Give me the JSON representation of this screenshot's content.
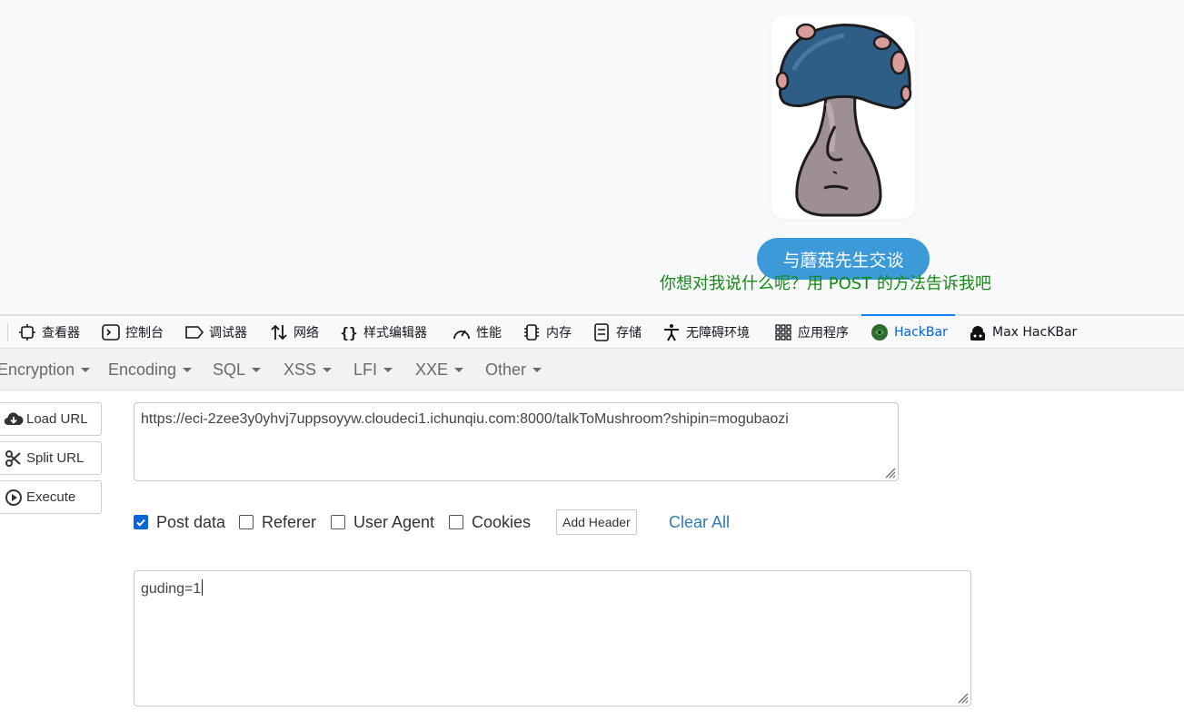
{
  "page": {
    "talk_button": "与蘑菇先生交谈",
    "hint": "你想对我说什么呢？用 POST 的方法告诉我吧"
  },
  "devtools": {
    "tabs": [
      {
        "label": "查看器",
        "icon": "inspector-icon"
      },
      {
        "label": "控制台",
        "icon": "console-icon"
      },
      {
        "label": "调试器",
        "icon": "debugger-icon"
      },
      {
        "label": "网络",
        "icon": "network-icon"
      },
      {
        "label": "样式编辑器",
        "icon": "style-editor-icon"
      },
      {
        "label": "性能",
        "icon": "performance-icon"
      },
      {
        "label": "内存",
        "icon": "memory-icon"
      },
      {
        "label": "存储",
        "icon": "storage-icon"
      },
      {
        "label": "无障碍环境",
        "icon": "accessibility-icon"
      },
      {
        "label": "应用程序",
        "icon": "application-icon"
      },
      {
        "label": "HackBar",
        "icon": "hackbar-icon",
        "active": true
      },
      {
        "label": "Max HacKBar",
        "icon": "max-hackbar-icon"
      }
    ],
    "active_color": "#0060df"
  },
  "hackbar": {
    "menu": [
      "Encryption",
      "Encoding",
      "SQL",
      "XSS",
      "LFI",
      "XXE",
      "Other"
    ],
    "buttons": {
      "load_url": "Load URL",
      "split_url": "Split URL",
      "execute": "Execute"
    },
    "url": "https://eci-2zee3y0yhvj7uppsoyyw.cloudeci1.ichunqiu.com:8000/talkToMushroom?shipin=mogubaozi",
    "options": [
      {
        "label": "Post data",
        "checked": true
      },
      {
        "label": "Referer",
        "checked": false
      },
      {
        "label": "User Agent",
        "checked": false
      },
      {
        "label": "Cookies",
        "checked": false
      }
    ],
    "add_header": "Add Header",
    "clear_all": "Clear All",
    "post_body": "guding=1"
  },
  "colors": {
    "button_blue": "#3d9ad9",
    "hint_green": "#138a13",
    "checkbox_blue": "#0b64d8",
    "link_blue": "#2f7ab8"
  }
}
